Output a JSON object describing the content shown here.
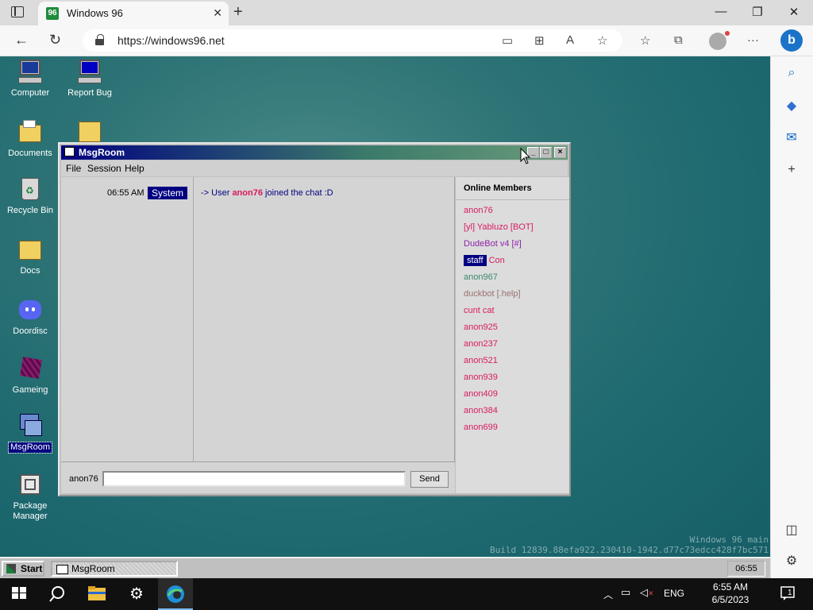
{
  "browser": {
    "tab_title": "Windows 96",
    "url": "https://windows96.net"
  },
  "desktop": {
    "icons": [
      {
        "label": "Computer"
      },
      {
        "label": "Report Bug"
      },
      {
        "label": "Documents"
      },
      {
        "label": "Recycle Bin"
      },
      {
        "label": "Docs"
      },
      {
        "label": "Doordisc"
      },
      {
        "label": "Gameing"
      },
      {
        "label": "MsgRoom"
      },
      {
        "label": "Package Manager"
      }
    ],
    "build_line1": "Windows 96 main",
    "build_line2": "Build 12839.88efa922.230410-1942.d77c73edcc428f7bc571"
  },
  "msgroom": {
    "title": "MsgRoom",
    "menu": [
      "File",
      "Session",
      "Help"
    ],
    "messages": [
      {
        "time": "06:55 AM",
        "sender": "System",
        "prefix": "-> User ",
        "user": "anon76",
        "suffix": " joined the chat :D"
      }
    ],
    "members_header": "Online Members",
    "members": [
      {
        "name": "anon76",
        "color": "#d81b60"
      },
      {
        "name": "[yl] Yabluzo [BOT]",
        "color": "#d81b60"
      },
      {
        "name": "DudeBot v4 [#]",
        "color": "#8e24aa"
      },
      {
        "badge": "staff",
        "name": "Con",
        "color": "#d81b60"
      },
      {
        "name": "anon967",
        "color": "#3a8a6a"
      },
      {
        "name": "duckbot [.help]",
        "color": "#9a7070"
      },
      {
        "name": "cunt cat",
        "color": "#d81b60"
      },
      {
        "name": "anon925",
        "color": "#d81b60"
      },
      {
        "name": "anon237",
        "color": "#d81b60"
      },
      {
        "name": "anon521",
        "color": "#d81b60"
      },
      {
        "name": "anon939",
        "color": "#d81b60"
      },
      {
        "name": "anon409",
        "color": "#d81b60"
      },
      {
        "name": "anon384",
        "color": "#d81b60"
      },
      {
        "name": "anon699",
        "color": "#d81b60"
      }
    ],
    "nick": "anon76",
    "input_value": "",
    "send_label": "Send"
  },
  "w96taskbar": {
    "start_label": "Start",
    "task_label": "MsgRoom",
    "clock": "06:55"
  },
  "w10taskbar": {
    "lang": "ENG",
    "time": "6:55 AM",
    "date": "6/5/2023",
    "notifications": "1"
  }
}
